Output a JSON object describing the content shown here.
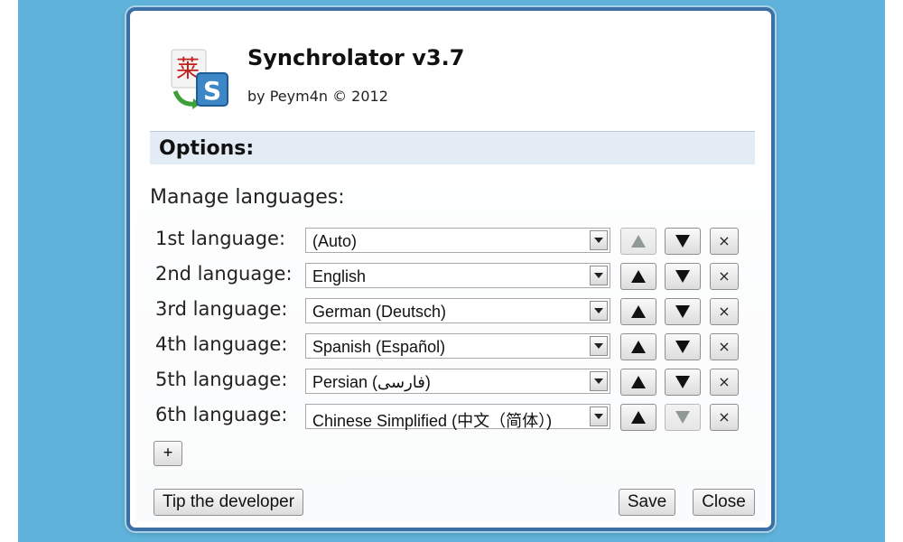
{
  "app": {
    "title": "Synchrolator v3.7",
    "credit": "by Peym4n © 2012",
    "logo_letter": "S",
    "logo_glyph": "莱"
  },
  "options": {
    "title": "Options:",
    "manage_label": "Manage languages:"
  },
  "languages": [
    {
      "label": "1st language:",
      "value": "(Auto)",
      "up_enabled": false,
      "down_enabled": true
    },
    {
      "label": "2nd language:",
      "value": "English",
      "up_enabled": true,
      "down_enabled": true
    },
    {
      "label": "3rd language:",
      "value": "German (Deutsch)",
      "up_enabled": true,
      "down_enabled": true
    },
    {
      "label": "4th language:",
      "value": "Spanish (Español)",
      "up_enabled": true,
      "down_enabled": true
    },
    {
      "label": "5th language:",
      "value": "Persian (فارسی)",
      "up_enabled": true,
      "down_enabled": true
    },
    {
      "label": "6th language:",
      "value": "Chinese Simplified (中文（简体）)",
      "up_enabled": true,
      "down_enabled": false
    }
  ],
  "buttons": {
    "add": "+",
    "remove": "×",
    "tip": "Tip the developer",
    "save": "Save",
    "close": "Close"
  },
  "icons": {
    "logo": "synchrolator-logo-icon",
    "dropdown": "chevron-down-icon",
    "move_up": "arrow-up-icon",
    "move_down": "arrow-down-icon",
    "remove": "close-icon"
  },
  "colors": {
    "backdrop": "#5fb2d9",
    "dialog_border": "#3c6fa3",
    "options_band": "#e3ecf4"
  }
}
